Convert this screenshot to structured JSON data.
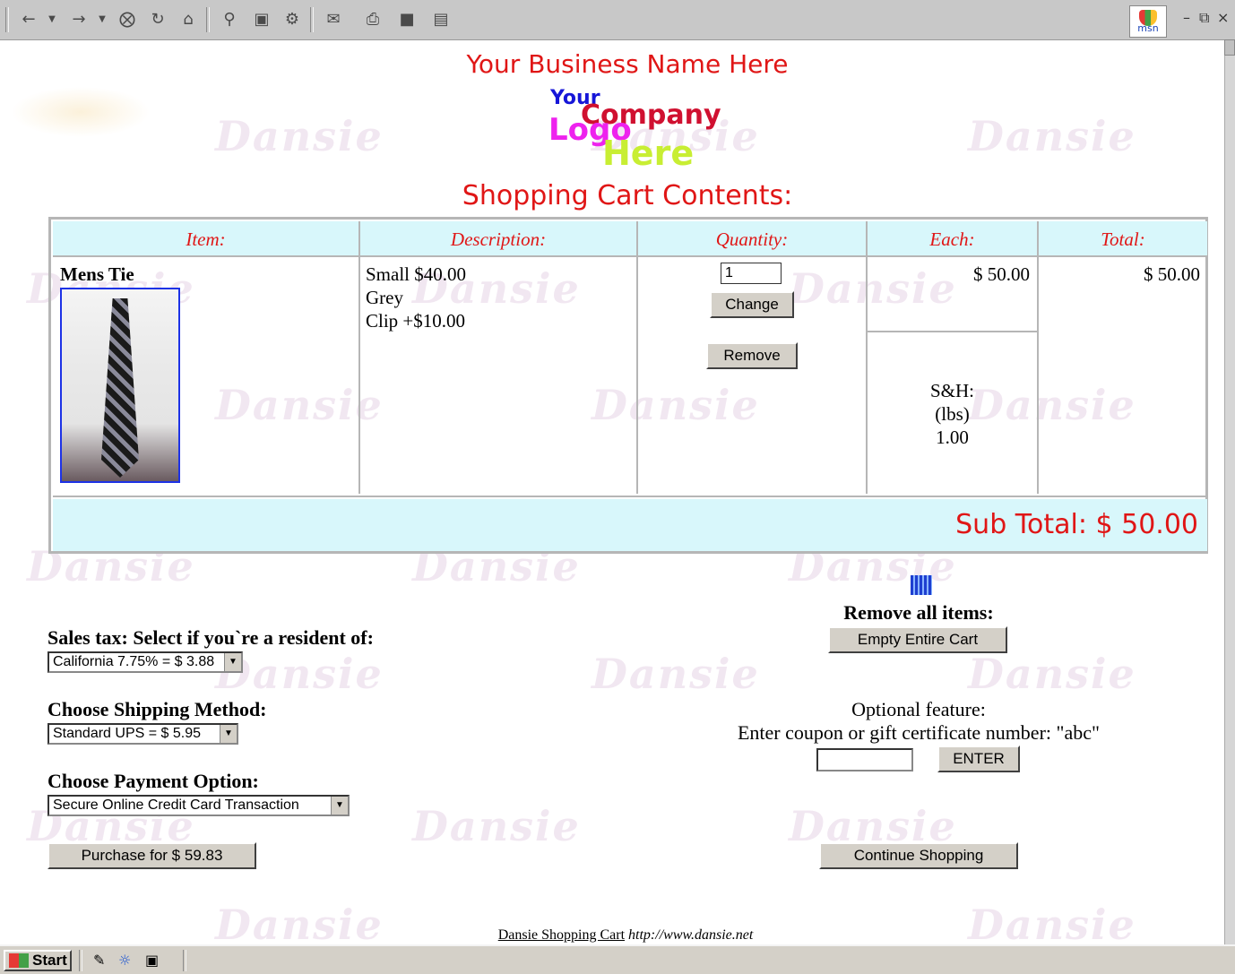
{
  "browser": {
    "toolbar_icons": [
      "back-arrow-icon",
      "forward-arrow-icon",
      "stop-icon",
      "refresh-icon",
      "home-icon",
      "search-icon",
      "favorites-icon",
      "history-icon",
      "mail-icon",
      "print-icon",
      "edit-icon",
      "discuss-icon"
    ],
    "msn_label": "msn"
  },
  "header": {
    "business_name": "Your Business Name Here",
    "logo": {
      "line1": "Your",
      "line2": "Company",
      "line3": "Logo",
      "line4": "Here"
    },
    "title": "Shopping Cart Contents:"
  },
  "cart": {
    "headers": {
      "item": "Item:",
      "description": "Description:",
      "quantity": "Quantity:",
      "each": "Each:",
      "total": "Total:"
    },
    "row": {
      "item": "Mens Tie",
      "description": [
        "Small $40.00",
        "Grey",
        "Clip +$10.00"
      ],
      "quantity": "1",
      "change_label": "Change",
      "remove_label": "Remove",
      "each": "$ 50.00",
      "sh": [
        "S&H:",
        "(lbs)",
        "1.00"
      ],
      "total": "$ 50.00"
    },
    "subtotal": "Sub Total: $ 50.00"
  },
  "options": {
    "sales_tax_label": "Sales tax: Select if you`re a resident of:",
    "sales_tax_value": "California 7.75% = $ 3.88",
    "shipping_label": "Choose Shipping Method:",
    "shipping_value": "Standard UPS = $ 5.95",
    "payment_label": "Choose Payment Option:",
    "payment_value": "Secure Online Credit Card Transaction",
    "purchase_label": "Purchase for $ 59.83"
  },
  "right_panel": {
    "remove_all_label": "Remove all items:",
    "empty_cart_label": "Empty Entire Cart",
    "optional_label": "Optional feature:",
    "coupon_label": "Enter coupon or gift certificate number: \"abc\"",
    "coupon_value": "",
    "enter_label": "ENTER",
    "continue_label": "Continue Shopping"
  },
  "footer": {
    "link_text": "Dansie Shopping Cart",
    "url_text": "http://www.dansie.net"
  },
  "taskbar": {
    "start_label": "Start"
  },
  "colors": {
    "accent_red": "#e01616",
    "header_cyan": "#d8f7fb",
    "border_gray": "#b6b6b6"
  }
}
